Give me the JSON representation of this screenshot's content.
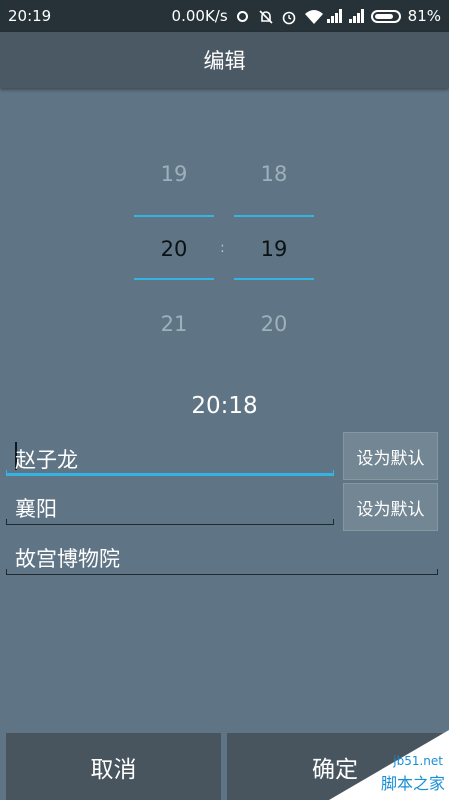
{
  "statusbar": {
    "time": "20:19",
    "speed": "0.00K/s",
    "battery": "81%"
  },
  "title": "编辑",
  "picker": {
    "hours": [
      "19",
      "20",
      "21"
    ],
    "minutes": [
      "18",
      "19",
      "20"
    ],
    "separator": ":"
  },
  "current_time": "20:18",
  "fields": [
    {
      "value": "赵子龙"
    },
    {
      "value": "襄阳"
    },
    {
      "value": "故宫博物院"
    }
  ],
  "set_default_label": "设为默认",
  "buttons": {
    "cancel": "取消",
    "confirm": "确定"
  },
  "watermark": {
    "site": "jb51.net",
    "name": "脚本之家"
  },
  "colors": {
    "background": "#5f7585",
    "accent": "#35b3e3",
    "titlebar": "#4a5963"
  },
  "icons": [
    "sync-icon",
    "alarm-off-icon",
    "alarm-icon",
    "wifi-icon",
    "signal-icon",
    "signal-icon",
    "battery-icon"
  ]
}
